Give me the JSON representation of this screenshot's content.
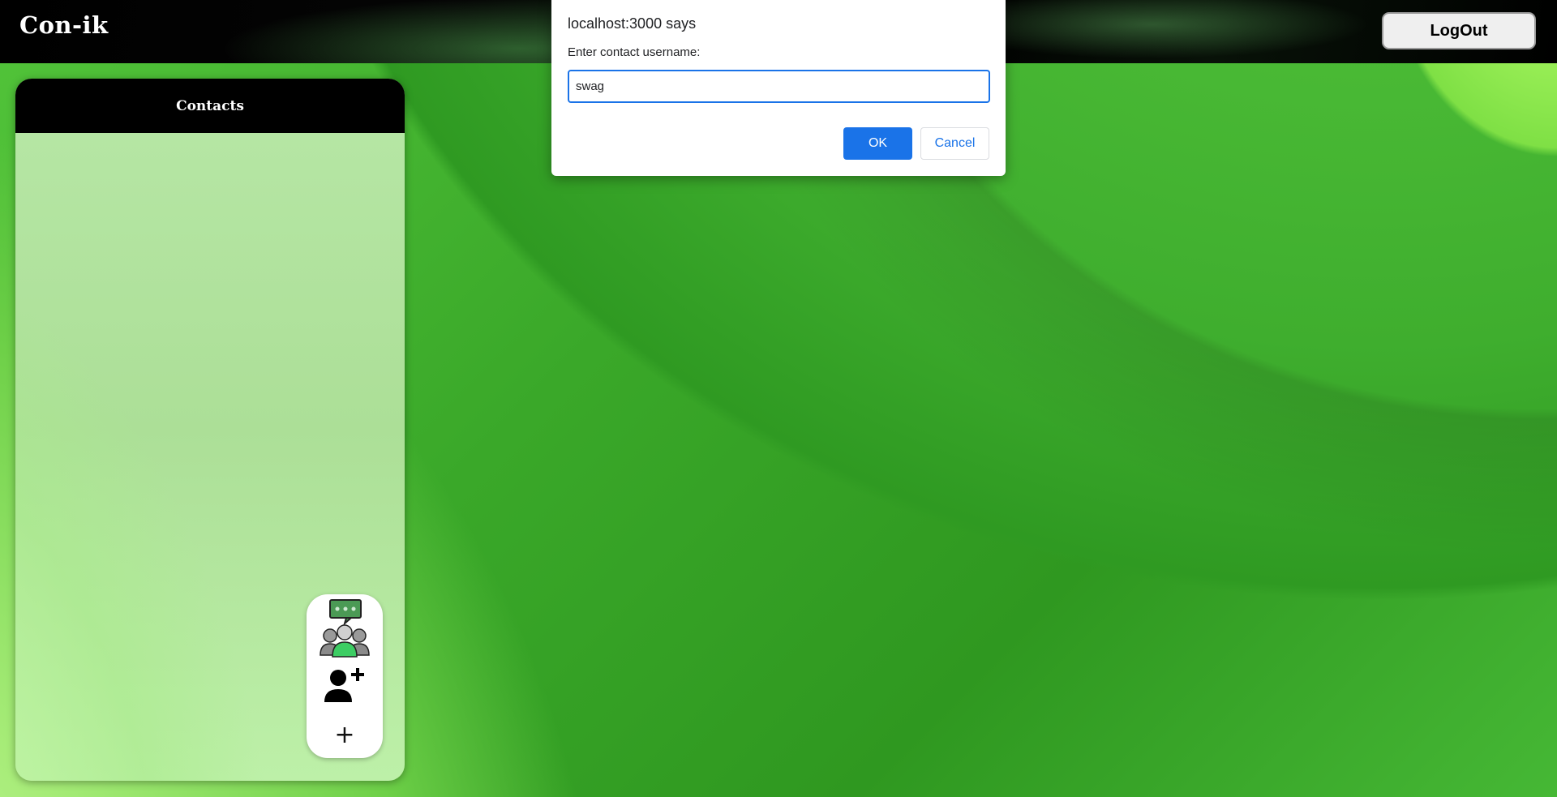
{
  "app": {
    "brand": "Con-ik",
    "logout_label": "LogOut"
  },
  "contacts": {
    "title": "Contacts",
    "actions": {
      "group_chat_icon": "group-chat-icon",
      "add_contact_icon": "add-contact-icon",
      "new_label": "+"
    }
  },
  "dialog": {
    "origin": "localhost:3000 says",
    "message": "Enter contact username:",
    "input_value": "swag",
    "ok_label": "OK",
    "cancel_label": "Cancel"
  },
  "colors": {
    "accent": "#1a73e8",
    "topbar": "#000000",
    "background_green": "#3aa829"
  }
}
